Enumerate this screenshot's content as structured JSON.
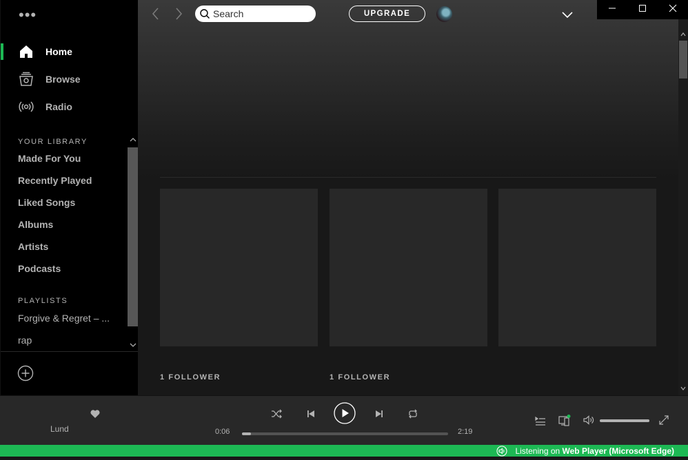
{
  "sidebar": {
    "menu_dots": "•••",
    "nav": [
      {
        "label": "Home",
        "icon": "home-icon",
        "active": true
      },
      {
        "label": "Browse",
        "icon": "browse-icon",
        "active": false
      },
      {
        "label": "Radio",
        "icon": "radio-icon",
        "active": false
      }
    ],
    "library_title": "YOUR LIBRARY",
    "library": [
      "Made For You",
      "Recently Played",
      "Liked Songs",
      "Albums",
      "Artists",
      "Podcasts"
    ],
    "playlists_title": "PLAYLISTS",
    "playlists": [
      "Forgive & Regret – ...",
      "rap"
    ],
    "new_playlist_icon": "add-circle-icon"
  },
  "topbar": {
    "search_placeholder": "Search",
    "upgrade_label": "UPGRADE"
  },
  "main": {
    "cards": [
      {
        "follower_text": "1 FOLLOWER"
      },
      {
        "follower_text": "1 FOLLOWER"
      },
      {
        "follower_text": ""
      }
    ]
  },
  "player": {
    "track_artist": "Lund",
    "elapsed": "0:06",
    "duration": "2:19",
    "progress_fraction": 0.043,
    "volume_fraction": 1.0
  },
  "connect_bar": {
    "prefix": "Listening on",
    "device": "Web Player (Microsoft Edge)"
  },
  "colors": {
    "accent": "#1db954",
    "sidebar_bg": "#000000",
    "player_bg": "#282828"
  }
}
